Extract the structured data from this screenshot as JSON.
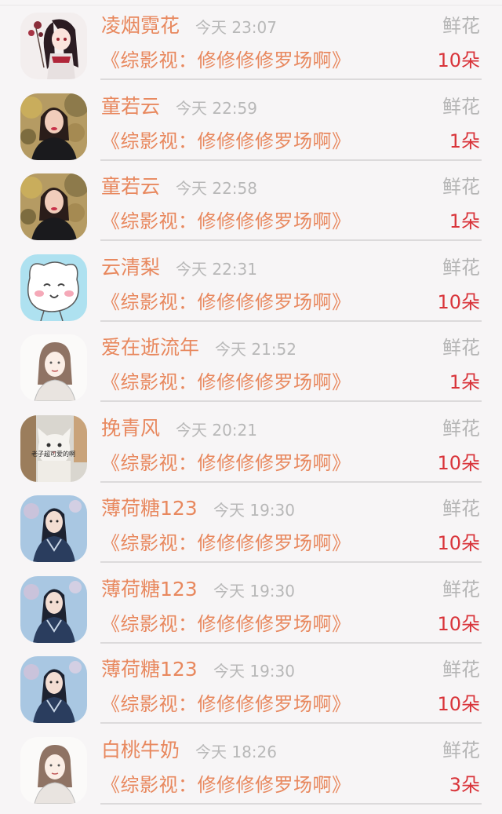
{
  "colors": {
    "name": "#e8885e",
    "book": "#e8885e",
    "time": "#b8b8b8",
    "gift_type": "#b5b5b5",
    "count": "#d9343a",
    "background": "#f7f5f6"
  },
  "records": [
    {
      "name": "凌烟霓花",
      "time": "今天 23:07",
      "gift_type": "鲜花",
      "book": "《综影视：修修修修罗场啊》",
      "count": "10朵",
      "avatar_icon": "anime-girl-flower-avatar"
    },
    {
      "name": "童若云",
      "time": "今天 22:59",
      "gift_type": "鲜花",
      "book": "《综影视：修修修修罗场啊》",
      "count": "1朵",
      "avatar_icon": "woman-photo-avatar"
    },
    {
      "name": "童若云",
      "time": "今天 22:58",
      "gift_type": "鲜花",
      "book": "《综影视：修修修修罗场啊》",
      "count": "1朵",
      "avatar_icon": "woman-photo-avatar"
    },
    {
      "name": "云清梨",
      "time": "今天 22:31",
      "gift_type": "鲜花",
      "book": "《综影视：修修修修罗场啊》",
      "count": "10朵",
      "avatar_icon": "cartoon-cat-avatar"
    },
    {
      "name": "爱在逝流年",
      "time": "今天 21:52",
      "gift_type": "鲜花",
      "book": "《综影视：修修修修罗场啊》",
      "count": "1朵",
      "avatar_icon": "sketch-girl-avatar"
    },
    {
      "name": "挽青风",
      "time": "今天 20:21",
      "gift_type": "鲜花",
      "book": "《综影视：修修修修罗场啊》",
      "count": "10朵",
      "avatar_icon": "white-cat-photo-avatar",
      "avatar_caption": "老子超可爱的啊"
    },
    {
      "name": "薄荷糖123",
      "time": "今天 19:30",
      "gift_type": "鲜花",
      "book": "《综影视：修修修修罗场啊》",
      "count": "10朵",
      "avatar_icon": "ancient-man-avatar"
    },
    {
      "name": "薄荷糖123",
      "time": "今天 19:30",
      "gift_type": "鲜花",
      "book": "《综影视：修修修修罗场啊》",
      "count": "10朵",
      "avatar_icon": "ancient-man-avatar"
    },
    {
      "name": "薄荷糖123",
      "time": "今天 19:30",
      "gift_type": "鲜花",
      "book": "《综影视：修修修修罗场啊》",
      "count": "10朵",
      "avatar_icon": "ancient-man-avatar"
    },
    {
      "name": "白桃牛奶",
      "time": "今天 18:26",
      "gift_type": "鲜花",
      "book": "《综影视：修修修修罗场啊》",
      "count": "3朵",
      "avatar_icon": "sketch-girl-avatar"
    }
  ]
}
